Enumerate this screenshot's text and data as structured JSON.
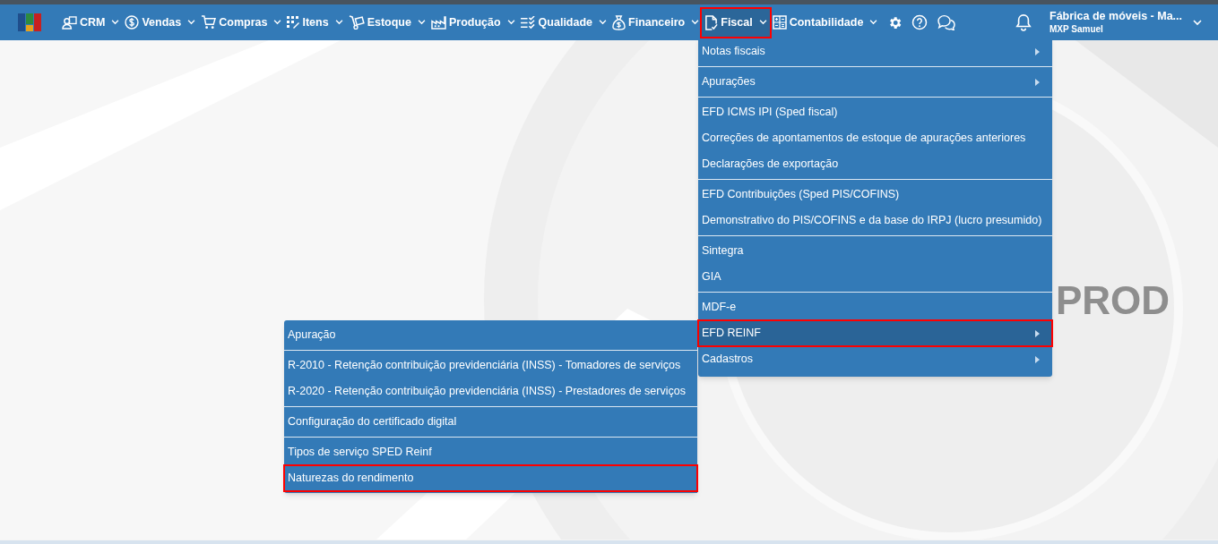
{
  "navbar": {
    "items": [
      {
        "label": "CRM",
        "selected": false,
        "annotated": false
      },
      {
        "label": "Vendas",
        "selected": false,
        "annotated": false
      },
      {
        "label": "Compras",
        "selected": false,
        "annotated": false
      },
      {
        "label": "Itens",
        "selected": false,
        "annotated": false
      },
      {
        "label": "Estoque",
        "selected": false,
        "annotated": false
      },
      {
        "label": "Produção",
        "selected": false,
        "annotated": false
      },
      {
        "label": "Qualidade",
        "selected": false,
        "annotated": false
      },
      {
        "label": "Financeiro",
        "selected": false,
        "annotated": false
      },
      {
        "label": "Fiscal",
        "selected": true,
        "annotated": true
      },
      {
        "label": "Contabilidade",
        "selected": false,
        "annotated": false
      }
    ],
    "company": "Fábrica de móveis - Ma...",
    "user": "MXP Samuel"
  },
  "background_text": "PROD",
  "fiscal_menu": {
    "groups": [
      [
        {
          "label": "Notas fiscais",
          "has_submenu": true,
          "selected": false,
          "annotated": false
        }
      ],
      [
        {
          "label": "Apurações",
          "has_submenu": true,
          "selected": false,
          "annotated": false
        }
      ],
      [
        {
          "label": "EFD ICMS IPI (Sped fiscal)",
          "has_submenu": false,
          "selected": false,
          "annotated": false
        },
        {
          "label": "Correções de apontamentos de estoque de apurações anteriores",
          "has_submenu": false,
          "selected": false,
          "annotated": false
        },
        {
          "label": "Declarações de exportação",
          "has_submenu": false,
          "selected": false,
          "annotated": false
        }
      ],
      [
        {
          "label": "EFD Contribuições (Sped PIS/COFINS)",
          "has_submenu": false,
          "selected": false,
          "annotated": false
        },
        {
          "label": "Demonstrativo do PIS/COFINS e da base do IRPJ (lucro presumido)",
          "has_submenu": false,
          "selected": false,
          "annotated": false
        }
      ],
      [
        {
          "label": "Sintegra",
          "has_submenu": false,
          "selected": false,
          "annotated": false
        },
        {
          "label": "GIA",
          "has_submenu": false,
          "selected": false,
          "annotated": false
        }
      ],
      [
        {
          "label": "MDF-e",
          "has_submenu": false,
          "selected": false,
          "annotated": false
        },
        {
          "label": "EFD REINF",
          "has_submenu": true,
          "selected": true,
          "annotated": true
        },
        {
          "label": "Cadastros",
          "has_submenu": true,
          "selected": false,
          "annotated": false
        }
      ]
    ]
  },
  "reinf_submenu": {
    "groups": [
      [
        {
          "label": "Apuração",
          "has_submenu": false,
          "selected": false,
          "annotated": false
        }
      ],
      [
        {
          "label": "R-2010 - Retenção contribuição previdenciária (INSS) - Tomadores de serviços",
          "has_submenu": false,
          "selected": false,
          "annotated": false
        },
        {
          "label": "R-2020 - Retenção contribuição previdenciária (INSS) - Prestadores de serviços",
          "has_submenu": false,
          "selected": false,
          "annotated": false
        }
      ],
      [
        {
          "label": "Configuração do certificado digital",
          "has_submenu": false,
          "selected": false,
          "annotated": false
        }
      ],
      [
        {
          "label": "Tipos de serviço SPED Reinf",
          "has_submenu": false,
          "selected": false,
          "annotated": false
        },
        {
          "label": "Naturezas do rendimento",
          "has_submenu": false,
          "selected": false,
          "annotated": true
        }
      ]
    ]
  }
}
